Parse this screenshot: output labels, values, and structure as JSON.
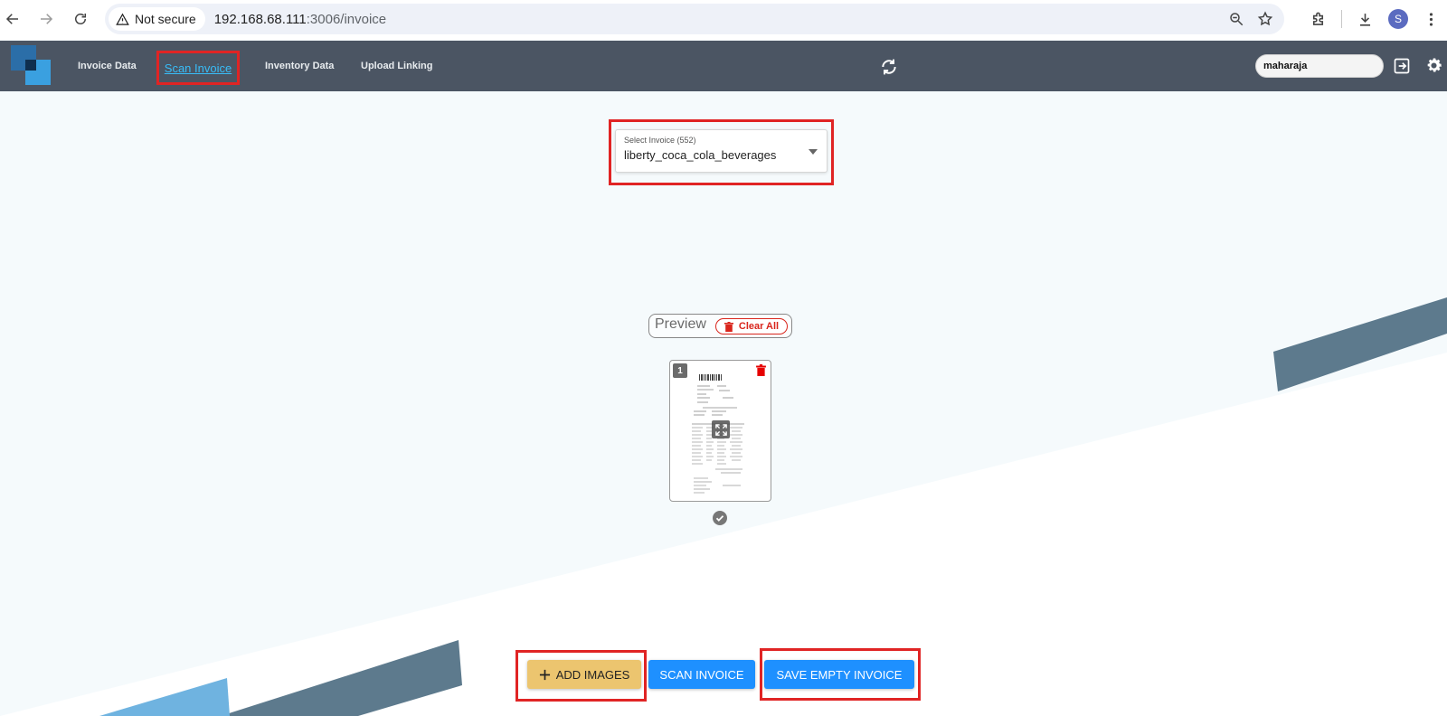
{
  "browser": {
    "security_label": "Not secure",
    "url_host": "192.168.68.111",
    "url_path": ":3006/invoice",
    "profile_initial": "S"
  },
  "header": {
    "nav": [
      {
        "label": "Invoice Data"
      },
      {
        "label": "Scan Invoice",
        "active": true
      },
      {
        "label": "Inventory Data"
      },
      {
        "label": "Upload Linking"
      }
    ],
    "store_value": "maharaja"
  },
  "invoice_select": {
    "label": "Select Invoice (552)",
    "value": "liberty_coca_cola_beverages"
  },
  "preview": {
    "title": "Preview",
    "clear_all_label": "Clear All",
    "images": [
      {
        "number": "1",
        "selected": true
      }
    ]
  },
  "actions": {
    "add_images_label": "ADD IMAGES",
    "scan_invoice_label": "SCAN INVOICE",
    "save_empty_label": "SAVE EMPTY INVOICE"
  },
  "colors": {
    "header_bg": "#4b5563",
    "highlight": "#e02424",
    "primary_button": "#1e90ff",
    "add_button": "#ecc56f",
    "danger": "#d9251c",
    "active_link": "#38bdf8"
  },
  "icons": [
    "back-arrow-icon",
    "forward-arrow-icon",
    "reload-icon",
    "warning-icon",
    "zoom-icon",
    "star-icon",
    "extensions-icon",
    "download-icon",
    "kebab-menu-icon",
    "refresh-icon",
    "logout-icon",
    "gear-icon",
    "trash-icon",
    "expand-icon",
    "check-circle-icon",
    "plus-icon",
    "dropdown-caret-icon"
  ]
}
